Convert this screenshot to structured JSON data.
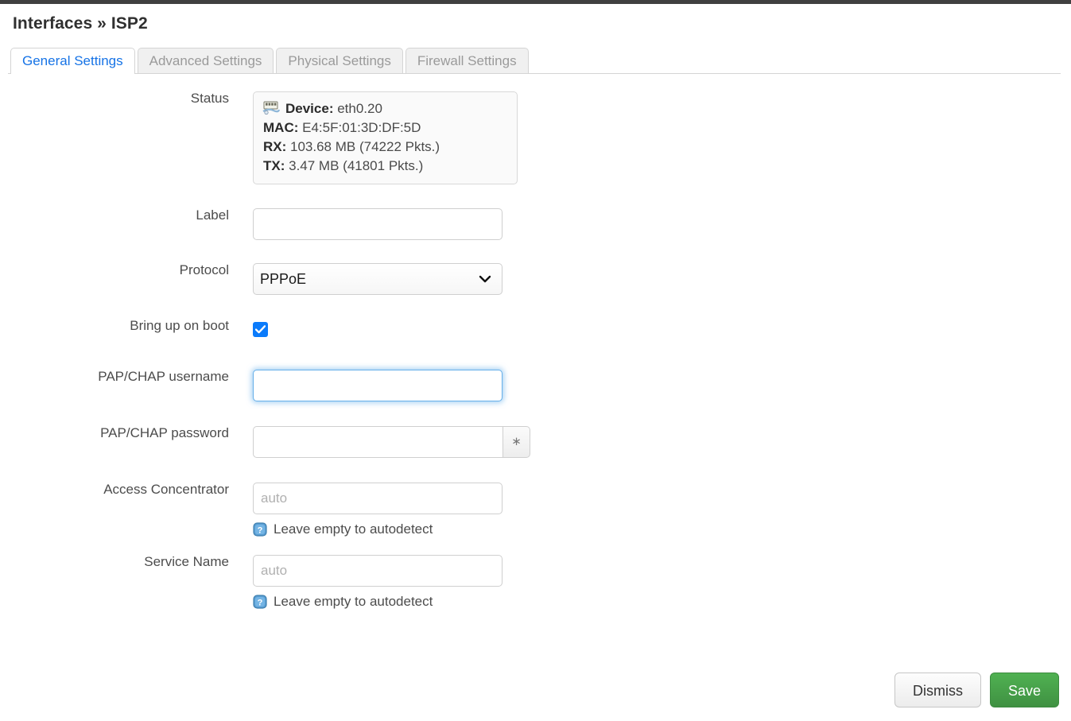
{
  "window": {
    "top_bar_color": "#404040"
  },
  "header": {
    "title": "Interfaces » ISP2"
  },
  "tabs": [
    {
      "label": "General Settings",
      "active": true
    },
    {
      "label": "Advanced Settings",
      "active": false
    },
    {
      "label": "Physical Settings",
      "active": false
    },
    {
      "label": "Firewall Settings",
      "active": false
    }
  ],
  "colors": {
    "accent_link": "#1673e6",
    "checkbox_blue": "#0b7bfb",
    "save_green": "#3f9142",
    "focus_blue": "#66afe9",
    "help_icon_blue": "#5a9fd4"
  },
  "form": {
    "status": {
      "label": "Status",
      "icon": "network-device-icon",
      "lines": [
        {
          "key": "Device:",
          "value": "eth0.20"
        },
        {
          "key": "MAC:",
          "value": "E4:5F:01:3D:DF:5D"
        },
        {
          "key": "RX:",
          "value": "103.68 MB (74222 Pkts.)"
        },
        {
          "key": "TX:",
          "value": "3.47 MB (41801 Pkts.)"
        }
      ]
    },
    "label_field": {
      "label": "Label",
      "value": "",
      "placeholder": ""
    },
    "protocol": {
      "label": "Protocol",
      "selected": "PPPoE",
      "options": [
        "PPPoE"
      ]
    },
    "bring_up_on_boot": {
      "label": "Bring up on boot",
      "checked": true
    },
    "pap_chap_username": {
      "label": "PAP/CHAP username",
      "value": "",
      "placeholder": "",
      "focused": true
    },
    "pap_chap_password": {
      "label": "PAP/CHAP password",
      "value": "",
      "placeholder": "",
      "reveal_button_label": "∗"
    },
    "access_concentrator": {
      "label": "Access Concentrator",
      "value": "",
      "placeholder": "auto",
      "hint": "Leave empty to autodetect",
      "hint_icon": "help-question-icon"
    },
    "service_name": {
      "label": "Service Name",
      "value": "",
      "placeholder": "auto",
      "hint": "Leave empty to autodetect",
      "hint_icon": "help-question-icon"
    }
  },
  "footer": {
    "dismiss_label": "Dismiss",
    "save_label": "Save"
  }
}
